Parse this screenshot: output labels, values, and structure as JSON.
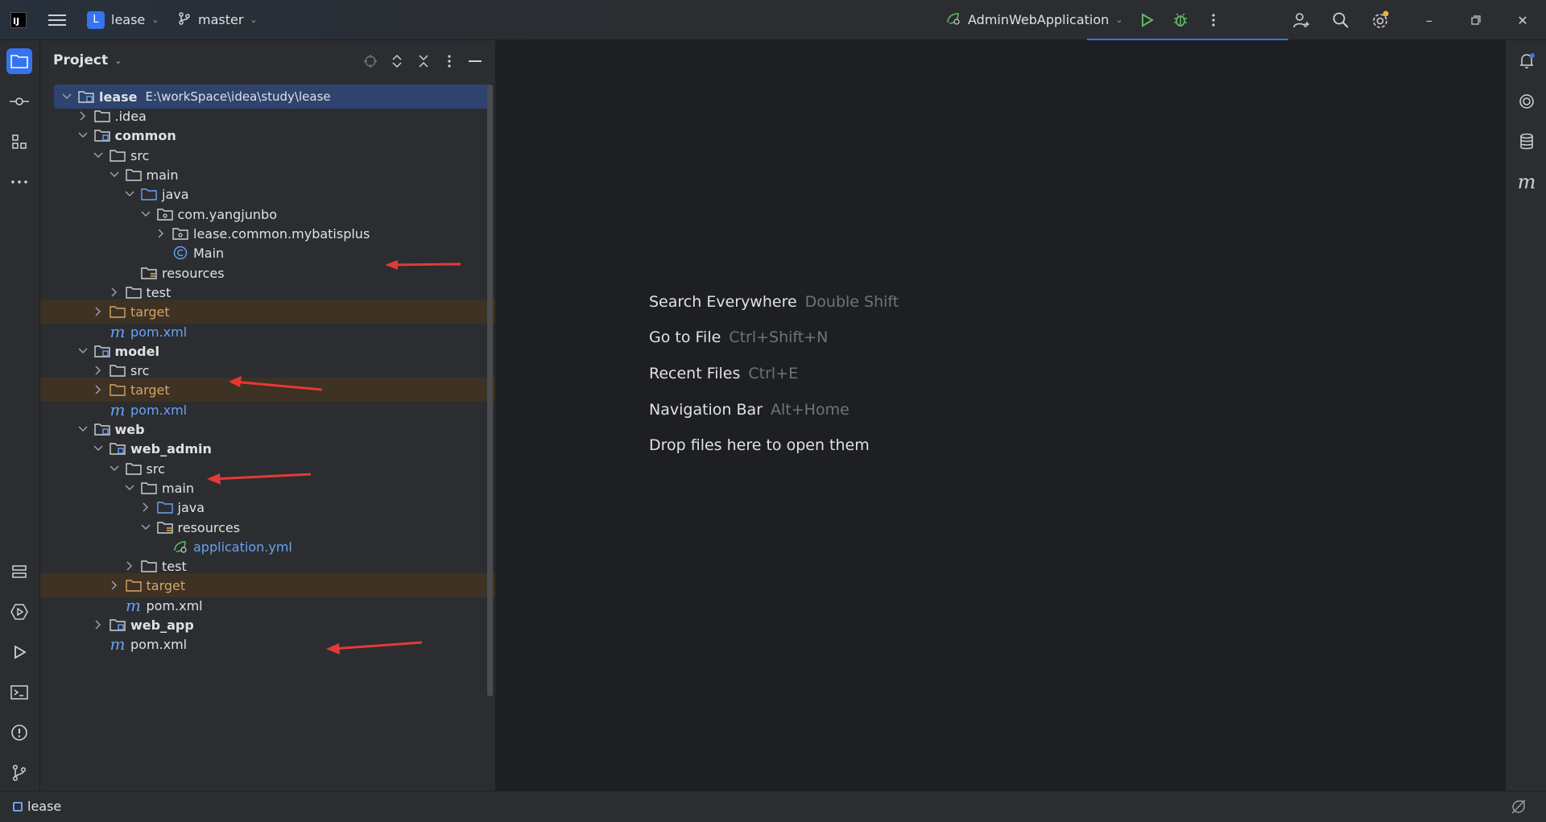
{
  "titlebar": {
    "project_badge": "L",
    "project_name": "lease",
    "branch": "master",
    "run_config": "AdminWebApplication",
    "icons": [
      "app-logo-icon",
      "main-menu-icon",
      "branch-icon",
      "spring-run-icon",
      "run-icon",
      "debug-icon",
      "more-icon",
      "add-user-icon",
      "search-icon",
      "settings-icon",
      "minimize-icon",
      "restore-icon",
      "close-icon"
    ]
  },
  "project_panel": {
    "title": "Project",
    "tree": [
      {
        "label": "lease",
        "path": "E:\\workSpace\\idea\\study\\lease",
        "kind": "module",
        "expanded": true,
        "bold": true,
        "selected": true
      },
      {
        "label": ".idea",
        "kind": "folder",
        "expanded": false
      },
      {
        "label": "common",
        "kind": "module",
        "expanded": true,
        "bold": true
      },
      {
        "label": "src",
        "kind": "folder",
        "expanded": true
      },
      {
        "label": "main",
        "kind": "folder",
        "expanded": true
      },
      {
        "label": "java",
        "kind": "source-folder",
        "expanded": true
      },
      {
        "label": "com.yangjunbo",
        "kind": "package",
        "expanded": true
      },
      {
        "label": "lease.common.mybatisplus",
        "kind": "package",
        "expanded": false
      },
      {
        "label": "Main",
        "kind": "class"
      },
      {
        "label": "resources",
        "kind": "resources-folder"
      },
      {
        "label": "test",
        "kind": "folder",
        "expanded": false
      },
      {
        "label": "target",
        "kind": "excluded-folder",
        "expanded": false
      },
      {
        "label": "pom.xml",
        "kind": "maven",
        "modified": true
      },
      {
        "label": "model",
        "kind": "module",
        "expanded": true,
        "bold": true
      },
      {
        "label": "src",
        "kind": "folder",
        "expanded": false
      },
      {
        "label": "target",
        "kind": "excluded-folder",
        "expanded": false
      },
      {
        "label": "pom.xml",
        "kind": "maven",
        "modified": true
      },
      {
        "label": "web",
        "kind": "module",
        "expanded": true,
        "bold": true
      },
      {
        "label": "web_admin",
        "kind": "module",
        "expanded": true,
        "bold": true
      },
      {
        "label": "src",
        "kind": "folder",
        "expanded": true
      },
      {
        "label": "main",
        "kind": "folder",
        "expanded": true
      },
      {
        "label": "java",
        "kind": "source-folder",
        "expanded": false
      },
      {
        "label": "resources",
        "kind": "resources-folder",
        "expanded": true
      },
      {
        "label": "application.yml",
        "kind": "spring-config",
        "modified": true
      },
      {
        "label": "test",
        "kind": "folder",
        "expanded": false
      },
      {
        "label": "target",
        "kind": "excluded-folder",
        "expanded": false
      },
      {
        "label": "pom.xml",
        "kind": "maven"
      },
      {
        "label": "web_app",
        "kind": "module",
        "expanded": false,
        "bold": true
      },
      {
        "label": "pom.xml",
        "kind": "maven"
      }
    ]
  },
  "editor": {
    "hints": [
      {
        "action": "Search Everywhere",
        "shortcut": "Double Shift"
      },
      {
        "action": "Go to File",
        "shortcut": "Ctrl+Shift+N"
      },
      {
        "action": "Recent Files",
        "shortcut": "Ctrl+E"
      },
      {
        "action": "Navigation Bar",
        "shortcut": "Alt+Home"
      },
      {
        "action": "Drop files here to open them",
        "shortcut": ""
      }
    ]
  },
  "statusbar": {
    "project": "lease"
  },
  "colors": {
    "accent": "#3574f0",
    "selection": "#2e436e",
    "excluded_bg": "#3d3223",
    "excluded_text": "#d5a467",
    "modified_text": "#6aa1f5",
    "annotation_arrow": "#e53935"
  }
}
